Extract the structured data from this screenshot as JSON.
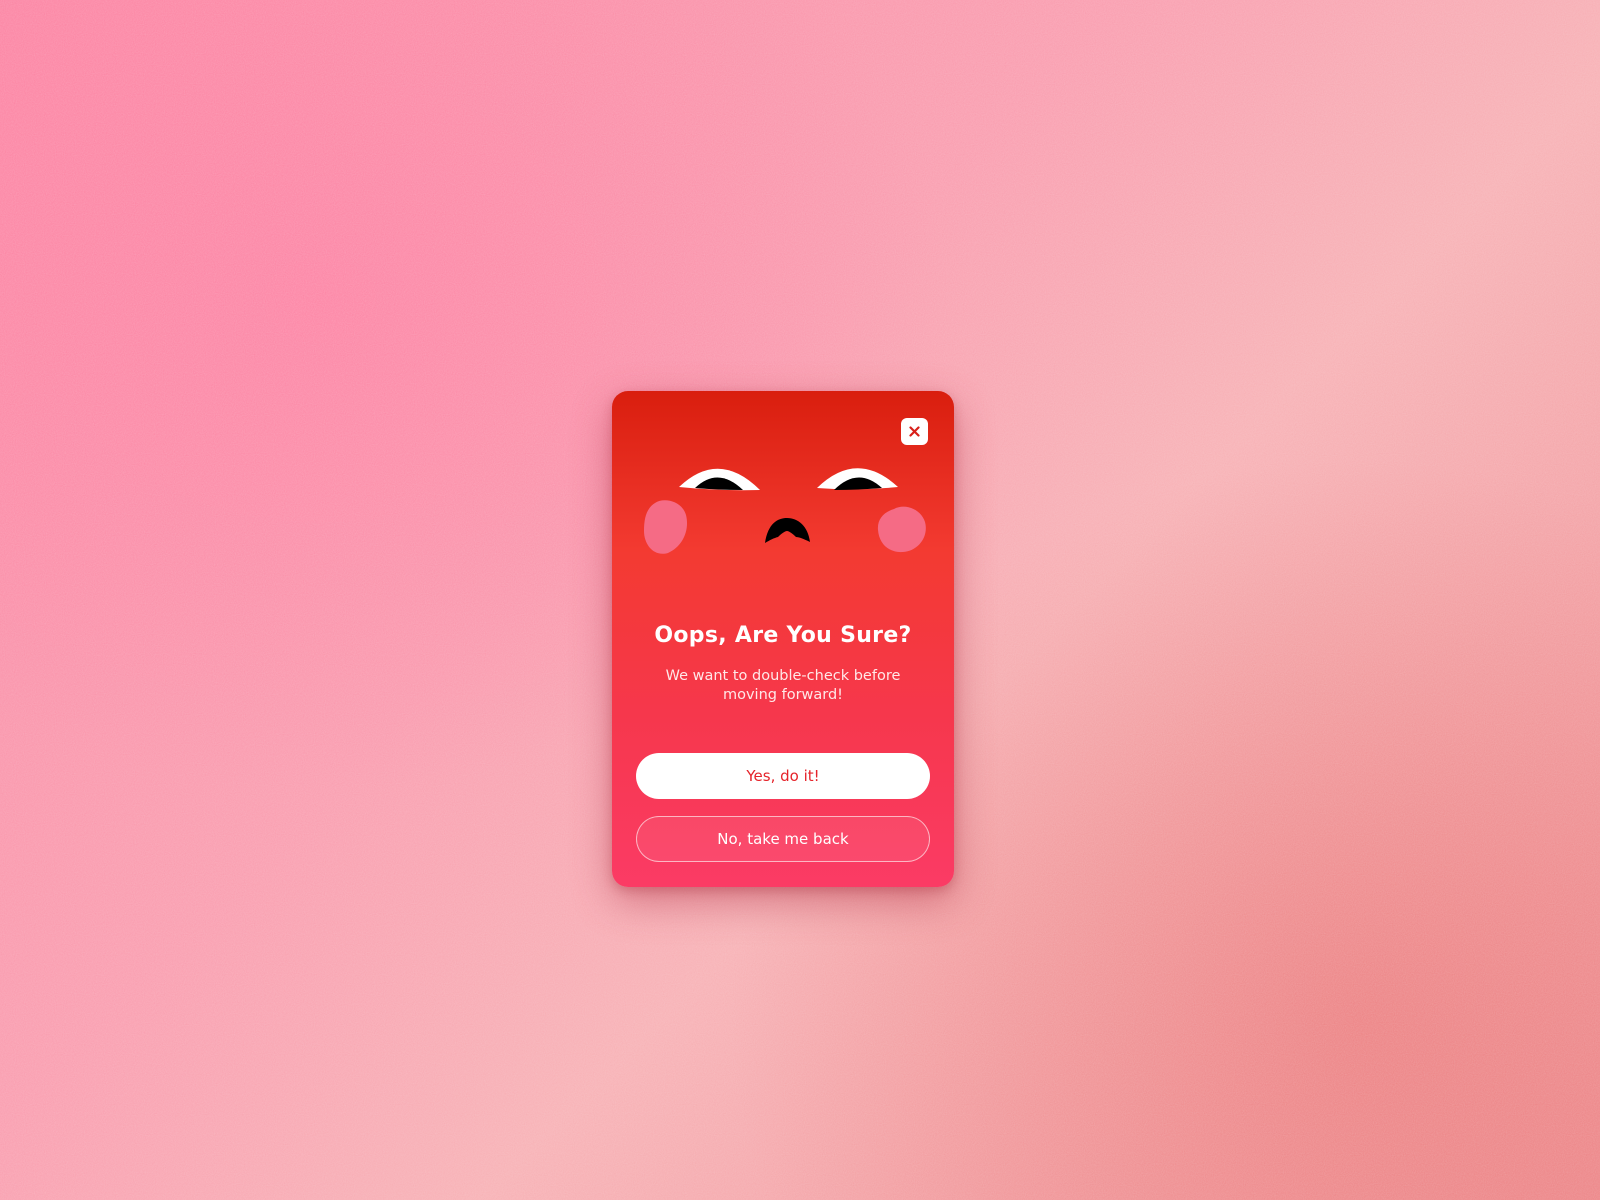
{
  "dialog": {
    "title": "Oops, Are You Sure?",
    "message": "We want to double-check before moving forward!",
    "confirm_label": "Yes, do it!",
    "cancel_label": "No, take me back",
    "close_icon": "close-icon",
    "illustration": "sad-face-illustration"
  },
  "colors": {
    "dialog_top": "#d91e0e",
    "dialog_bottom": "#fb3b65",
    "confirm_text": "#e5232a",
    "cheek": "#f56b85",
    "background": "#f99cae"
  }
}
